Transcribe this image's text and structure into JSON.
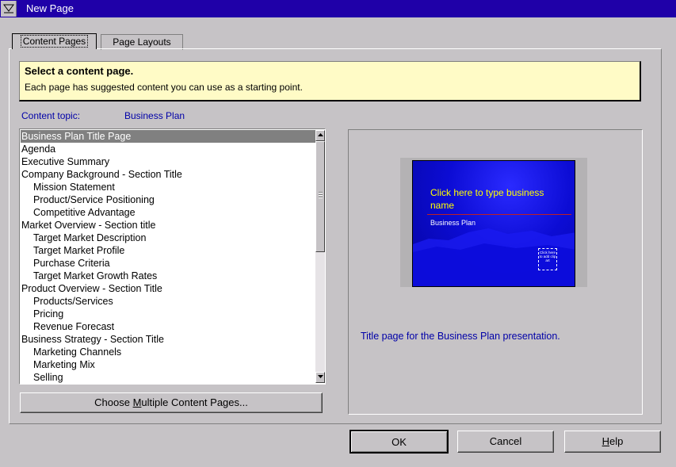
{
  "window": {
    "title": "New Page"
  },
  "tabs": [
    {
      "label": "Content Pages",
      "active": true
    },
    {
      "label": "Page Layouts",
      "active": false
    }
  ],
  "info": {
    "title": "Select a content page.",
    "description": "Each page has suggested content you can use as a starting point."
  },
  "topic": {
    "label": "Content topic:",
    "value": "Business Plan"
  },
  "list": {
    "items": [
      {
        "label": "Business Plan Title Page",
        "indent": false,
        "selected": true
      },
      {
        "label": "Agenda",
        "indent": false
      },
      {
        "label": "Executive Summary",
        "indent": false
      },
      {
        "label": "Company Background - Section Title",
        "indent": false
      },
      {
        "label": "Mission Statement",
        "indent": true
      },
      {
        "label": "Product/Service Positioning",
        "indent": true
      },
      {
        "label": "Competitive Advantage",
        "indent": true
      },
      {
        "label": "Market Overview - Section title",
        "indent": false
      },
      {
        "label": "Target Market Description",
        "indent": true
      },
      {
        "label": "Target Market Profile",
        "indent": true
      },
      {
        "label": "Purchase Criteria",
        "indent": true
      },
      {
        "label": "Target Market Growth Rates",
        "indent": true
      },
      {
        "label": "Product Overview - Section Title",
        "indent": false
      },
      {
        "label": "Products/Services",
        "indent": true
      },
      {
        "label": "Pricing",
        "indent": true
      },
      {
        "label": "Revenue Forecast",
        "indent": true
      },
      {
        "label": "Business Strategy - Section Title",
        "indent": false
      },
      {
        "label": "Marketing Channels",
        "indent": true
      },
      {
        "label": "Marketing Mix",
        "indent": true
      },
      {
        "label": "Selling",
        "indent": true
      }
    ]
  },
  "buttons": {
    "multi_pre": "Choose ",
    "multi_u": "M",
    "multi_post": "ultiple Content Pages...",
    "ok": "OK",
    "cancel": "Cancel",
    "help_u": "H",
    "help_post": "elp"
  },
  "preview": {
    "slide_title": "Click here to type business name",
    "slide_subtitle": "Business Plan",
    "clip_text": "Click here to add clip art",
    "description": "Title page for the Business Plan presentation."
  },
  "colors": {
    "titlebar": "#1f00a8",
    "info_bg": "#fffbc6",
    "link_blue": "#0000a8",
    "selection": "#808080"
  }
}
